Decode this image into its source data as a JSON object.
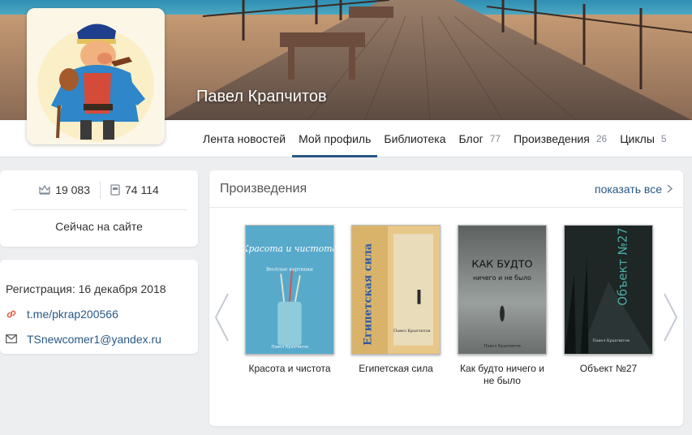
{
  "profile": {
    "name": "Павел Крапчитов"
  },
  "tabs": [
    {
      "label": "Лента новостей",
      "count": ""
    },
    {
      "label": "Мой профиль",
      "count": ""
    },
    {
      "label": "Библиотека",
      "count": ""
    },
    {
      "label": "Блог",
      "count": "77"
    },
    {
      "label": "Произведения",
      "count": "26"
    },
    {
      "label": "Циклы",
      "count": "5"
    }
  ],
  "stats": {
    "crowns": "19 083",
    "books": "74 114",
    "online": "Сейчас на сайте"
  },
  "info": {
    "registration": "Регистрация: 16 декабря 2018",
    "telegram": "t.me/pkrap200566",
    "email": "TSnewcomer1@yandex.ru"
  },
  "works": {
    "title": "Произведения",
    "show_all": "показать все",
    "items": [
      {
        "title": "Красота и чистота",
        "cover_title": "Красота и чистота",
        "cover_sub": "Весёлые картинки",
        "cover_author": "Павел Крапчитов",
        "color": "#58aacb"
      },
      {
        "title": "Египетская сила",
        "cover_title": "Египетская сила",
        "cover_author": "Павел Крапчитов",
        "color": "#e3b561"
      },
      {
        "title": "Как будто ничего и не было",
        "cover_title": "КАК БУДТО",
        "cover_sub": "ничего и не было",
        "cover_author": "Павел Крапчитов",
        "color": "#6f7372"
      },
      {
        "title": "Объект №27",
        "cover_title": "Объект №27",
        "cover_author": "Павел Крапчитов",
        "color": "#1e2626"
      }
    ]
  },
  "colors": {
    "link": "#2a5885",
    "active_tab": "#2a5885",
    "background": "#edeef0"
  },
  "icons": {
    "crowns": "crown-icon",
    "books": "book-icon",
    "telegram": "link-icon",
    "email": "mail-icon",
    "next": "chevron-right-icon",
    "prev": "chevron-left-icon"
  }
}
